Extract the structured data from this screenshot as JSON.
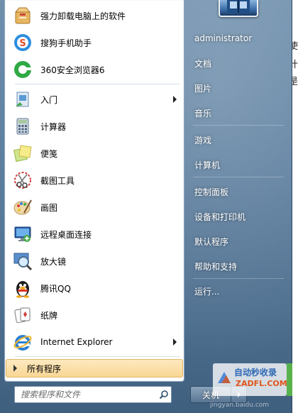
{
  "programs": [
    {
      "label": "强力卸载电脑上的软件",
      "icon": "uninstall-box-icon",
      "arrow": false
    },
    {
      "label": "搜狗手机助手",
      "icon": "sogou-icon",
      "arrow": false
    },
    {
      "label": "360安全浏览器6",
      "icon": "360-browser-icon",
      "arrow": false
    },
    {
      "label": "入门",
      "icon": "getting-started-icon",
      "arrow": true
    },
    {
      "label": "计算器",
      "icon": "calculator-icon",
      "arrow": false
    },
    {
      "label": "便笺",
      "icon": "sticky-notes-icon",
      "arrow": false
    },
    {
      "label": "截图工具",
      "icon": "snipping-tool-icon",
      "arrow": false
    },
    {
      "label": "画图",
      "icon": "paint-icon",
      "arrow": false
    },
    {
      "label": "远程桌面连接",
      "icon": "remote-desktop-icon",
      "arrow": false
    },
    {
      "label": "放大镜",
      "icon": "magnifier-icon",
      "arrow": false
    },
    {
      "label": "腾讯QQ",
      "icon": "qq-penguin-icon",
      "arrow": false
    },
    {
      "label": "纸牌",
      "icon": "solitaire-icon",
      "arrow": false
    },
    {
      "label": "Internet Explorer",
      "icon": "internet-explorer-icon",
      "arrow": true
    }
  ],
  "all_programs": {
    "label": "所有程序"
  },
  "search": {
    "placeholder": "搜索程序和文件"
  },
  "right_panel": {
    "user": "administrator",
    "items": [
      "文档",
      "图片",
      "音乐",
      "游戏",
      "计算机",
      "控制面板",
      "设备和打印机",
      "默认程序",
      "帮助和支持",
      "运行..."
    ]
  },
  "shutdown": {
    "label": "关机"
  },
  "desktop_edge_text": [
    "使",
    "计",
    "是"
  ],
  "watermark": {
    "top": "自动秒收录",
    "bottom": "ZADFL.COM"
  },
  "credit": "jingyan.baidu.com"
}
